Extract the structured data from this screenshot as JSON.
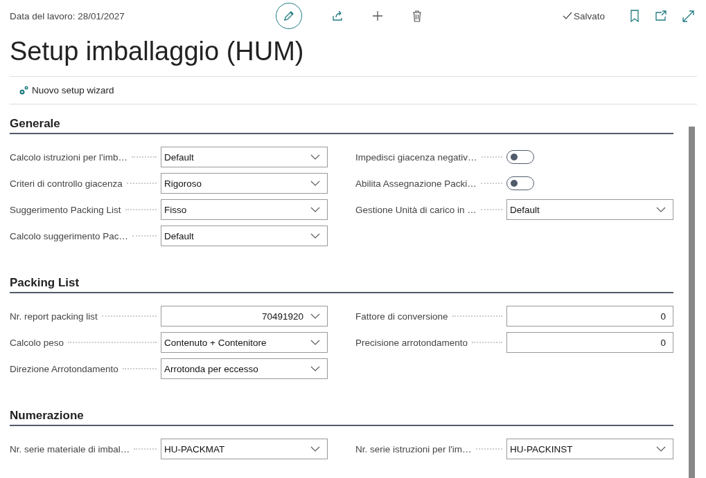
{
  "header": {
    "work_date": "Data del lavoro: 28/01/2027",
    "status": "Salvato",
    "title": "Setup imballaggio (HUM)"
  },
  "actions": [
    {
      "label": "Nuovo setup wizard"
    }
  ],
  "sections": [
    {
      "title": "Generale",
      "left": [
        {
          "kind": "dropdown",
          "label": "Calcolo istruzioni per l'imb…",
          "value": "Default",
          "numeric": false
        },
        {
          "kind": "dropdown",
          "label": "Criteri di controllo giacenza",
          "value": "Rigoroso",
          "numeric": false
        },
        {
          "kind": "dropdown",
          "label": "Suggerimento Packing List",
          "value": "Fisso",
          "numeric": false
        },
        {
          "kind": "dropdown",
          "label": "Calcolo suggerimento Pac…",
          "value": "Default",
          "numeric": false
        }
      ],
      "right": [
        {
          "kind": "toggle",
          "label": "Impedisci giacenza negativ…",
          "on": false
        },
        {
          "kind": "toggle",
          "label": "Abilita Assegnazione Packi…",
          "on": false
        },
        {
          "kind": "dropdown",
          "label": "Gestione Unità di carico in …",
          "value": "Default",
          "numeric": false
        }
      ]
    },
    {
      "title": "Packing List",
      "left": [
        {
          "kind": "dropdown",
          "label": "Nr. report packing list",
          "value": "70491920",
          "numeric": true
        },
        {
          "kind": "dropdown",
          "label": "Calcolo peso",
          "value": "Contenuto + Contenitore",
          "numeric": false
        },
        {
          "kind": "dropdown",
          "label": "Direzione Arrotondamento",
          "value": "Arrotonda per eccesso",
          "numeric": false
        }
      ],
      "right": [
        {
          "kind": "number",
          "label": "Fattore di conversione",
          "value": "0"
        },
        {
          "kind": "number",
          "label": "Precisione arrotondamento",
          "value": "0"
        }
      ]
    },
    {
      "title": "Numerazione",
      "left": [
        {
          "kind": "dropdown",
          "label": "Nr. serie materiale di imbal…",
          "value": "HU-PACKMAT",
          "numeric": false
        }
      ],
      "right": [
        {
          "kind": "dropdown",
          "label": "Nr. serie istruzioni per l'im…",
          "value": "HU-PACKINST",
          "numeric": false
        }
      ]
    }
  ]
}
